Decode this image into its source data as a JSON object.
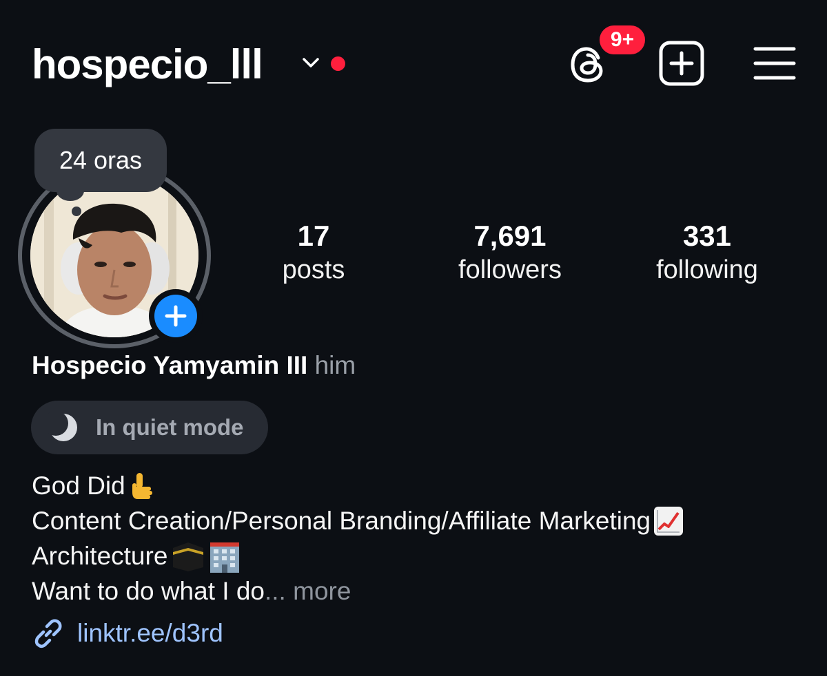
{
  "header": {
    "username": "hospecio_lll",
    "notification_badge": "9+"
  },
  "profile": {
    "note": "24 oras",
    "display_name": "Hospecio Yamyamin III",
    "pronoun": "him",
    "quiet_mode_label": "In quiet mode"
  },
  "stats": {
    "posts_count": "17",
    "posts_label": "posts",
    "followers_count": "7,691",
    "followers_label": "followers",
    "following_count": "331",
    "following_label": "following"
  },
  "bio": {
    "line1": "God Did",
    "line2": "Content Creation/Personal Branding/Affiliate Marketing",
    "line3": "Architecture",
    "line4": "Want to do what I do",
    "ellipsis": "...",
    "more_label": " more",
    "link": "linktr.ee/d3rd"
  },
  "icons": {
    "chevron": "chevron-down-icon",
    "threads": "threads-icon",
    "create": "plus-square-icon",
    "menu": "hamburger-menu-icon",
    "story_add": "plus-circle-icon",
    "moon": "moon-icon",
    "link": "link-icon"
  },
  "colors": {
    "background": "#0c0f14",
    "badge_red": "#ff1f3d",
    "accent_blue": "#1a8cff",
    "link_blue": "#9fc4ff"
  }
}
